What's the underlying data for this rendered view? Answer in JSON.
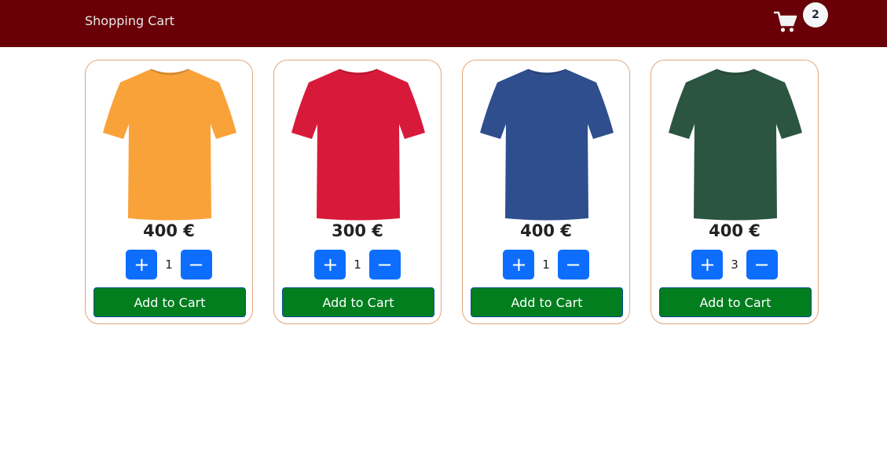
{
  "navbar": {
    "brand": "Shopping Cart",
    "cart_count": "2",
    "background": "#690007"
  },
  "products": [
    {
      "price": "400 €",
      "quantity": "1",
      "color": "#f9a23a",
      "add_label": "Add to Cart",
      "plus_label": "+",
      "minus_label": "−"
    },
    {
      "price": "300 €",
      "quantity": "1",
      "color": "#d81a3a",
      "add_label": "Add to Cart",
      "plus_label": "+",
      "minus_label": "−"
    },
    {
      "price": "400 €",
      "quantity": "1",
      "color": "#2f4e8e",
      "add_label": "Add to Cart",
      "plus_label": "+",
      "minus_label": "−"
    },
    {
      "price": "400 €",
      "quantity": "3",
      "color": "#2b5540",
      "add_label": "Add to Cart",
      "plus_label": "+",
      "minus_label": "−"
    }
  ],
  "colors": {
    "qty_button": "#0d6efd",
    "add_button": "#027e1e",
    "card_border": "#e2a77a"
  },
  "icons": {
    "cart": "shopping-cart-icon"
  }
}
